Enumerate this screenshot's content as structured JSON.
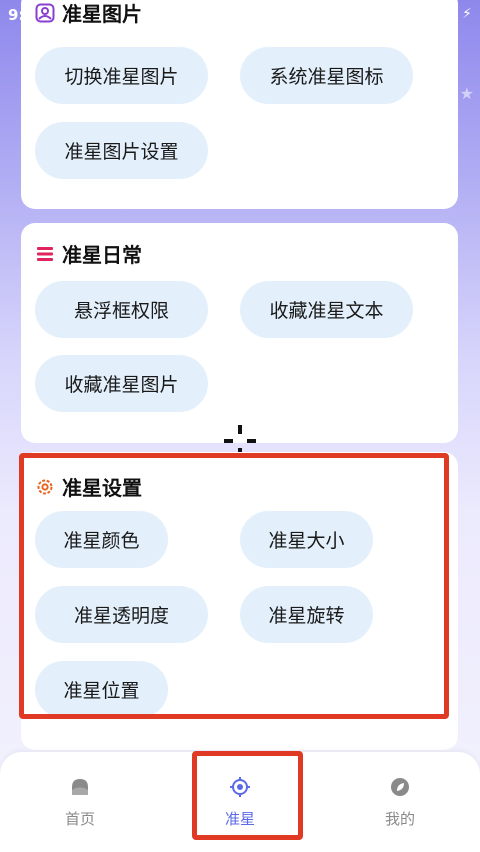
{
  "status_bar": {
    "time": "9:",
    "battery_glyph": "⚡"
  },
  "cards": [
    {
      "title": "准星图片",
      "icon": "image-settings-icon",
      "icon_color": "#8a3fd1",
      "buttons": [
        "切换准星图片",
        "系统准星图标",
        "准星图片设置"
      ]
    },
    {
      "title": "准星日常",
      "icon": "menu-lines-icon",
      "icon_color": "#e0245e",
      "buttons": [
        "悬浮框权限",
        "收藏准星文本",
        "收藏准星图片"
      ]
    },
    {
      "title": "准星设置",
      "icon": "gear-icon",
      "icon_color": "#e8641f",
      "buttons": [
        "准星颜色",
        "准星大小",
        "准星透明度",
        "准星旋转",
        "准星位置"
      ]
    }
  ],
  "bottom_nav": [
    {
      "label": "首页",
      "icon": "home-icon",
      "active": false
    },
    {
      "label": "准星",
      "icon": "crosshair-icon",
      "active": true
    },
    {
      "label": "我的",
      "icon": "profile-leaf-icon",
      "active": false
    }
  ],
  "colors": {
    "accent": "#5b6ae8",
    "pill_bg": "#e3f0fb",
    "highlight": "#e03a24",
    "header_gradient_top": "#8e88ec"
  }
}
